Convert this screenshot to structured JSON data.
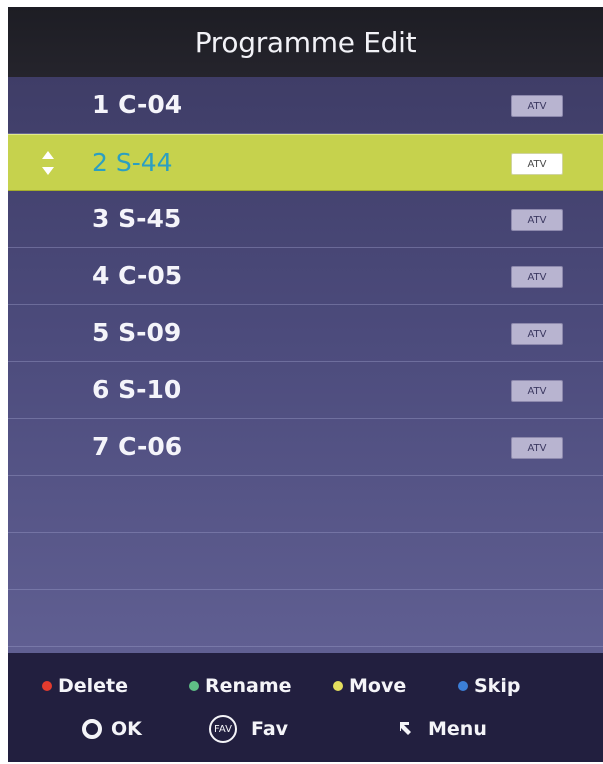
{
  "title": "Programme Edit",
  "channels": [
    {
      "label": "1 C-04",
      "type": "ATV"
    },
    {
      "label": "2 S-44",
      "type": "ATV"
    },
    {
      "label": "3 S-45",
      "type": "ATV"
    },
    {
      "label": "4 C-05",
      "type": "ATV"
    },
    {
      "label": "5 S-09",
      "type": "ATV"
    },
    {
      "label": "6 S-10",
      "type": "ATV"
    },
    {
      "label": "7 C-06",
      "type": "ATV"
    }
  ],
  "selected_index": 1,
  "footer": {
    "delete_label": "Delete",
    "rename_label": "Rename",
    "move_label": "Move",
    "skip_label": "Skip",
    "ok_label": "OK",
    "fav_icon_text": "FAV",
    "fav_label": "Fav",
    "menu_label": "Menu"
  },
  "colors": {
    "delete": "#e23b2e",
    "rename": "#5fbf86",
    "move": "#e4de5e",
    "skip": "#3c7fd8",
    "selected_row": "#c6d24d",
    "selected_text": "#2b9fc2"
  }
}
